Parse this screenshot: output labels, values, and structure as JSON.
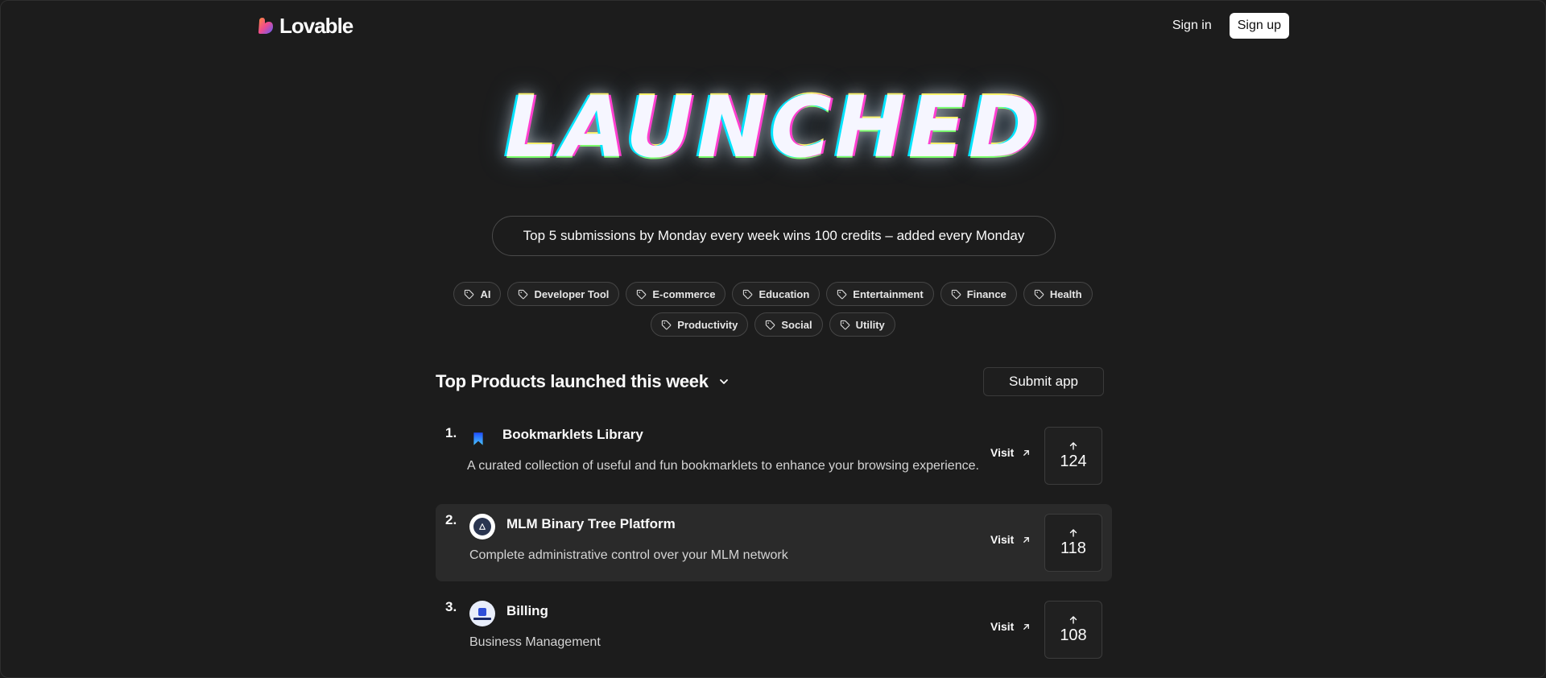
{
  "header": {
    "logo_text": "Lovable",
    "signin_label": "Sign in",
    "signup_label": "Sign up"
  },
  "hero": {
    "title": "LAUNCHED"
  },
  "banner": {
    "text": "Top 5 submissions by Monday every week wins 100 credits – added every Monday"
  },
  "tags": {
    "row1": [
      "AI",
      "Developer Tool",
      "E-commerce",
      "Education",
      "Entertainment",
      "Finance",
      "Health"
    ],
    "row2": [
      "Productivity",
      "Social",
      "Utility"
    ]
  },
  "section": {
    "title": "Top Products launched this week",
    "submit_label": "Submit app"
  },
  "products": [
    {
      "rank": "1.",
      "name": "Bookmarklets Library",
      "description": "A curated collection of useful and fun bookmarklets to enhance your browsing experience.",
      "visit_label": "Visit",
      "votes": "124",
      "icon": "bookmark-icon"
    },
    {
      "rank": "2.",
      "name": "MLM Binary Tree Platform",
      "description": "Complete administrative control over your MLM network",
      "visit_label": "Visit",
      "votes": "118",
      "icon": "triangle-logo-icon"
    },
    {
      "rank": "3.",
      "name": "Billing",
      "description": "Business Management",
      "visit_label": "Visit",
      "votes": "108",
      "icon": "billing-logo-icon"
    }
  ],
  "colors": {
    "background": "#1c1c1c",
    "highlight_row": "#2a2a2a",
    "text": "#fafafa",
    "brand_gradient": [
      "#ff6b3d",
      "#e94ba3",
      "#6a5cff"
    ]
  }
}
